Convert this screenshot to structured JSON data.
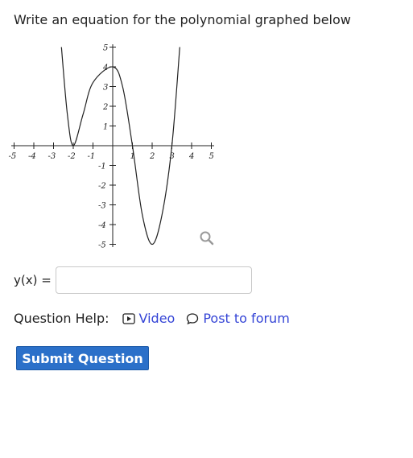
{
  "question": {
    "prompt": "Write an equation for the polynomial graphed below"
  },
  "graph": {
    "x_ticks": [
      -5,
      -4,
      -3,
      -2,
      -1,
      1,
      2,
      3,
      4,
      5
    ],
    "y_ticks": [
      -5,
      -4,
      -3,
      -2,
      -1,
      1,
      2,
      3,
      4,
      5
    ],
    "x_tick_labels": [
      "-5",
      "-4",
      "-3",
      "-2",
      "-1",
      "1",
      "2",
      "3",
      "4",
      "5"
    ],
    "y_tick_labels": [
      "-5",
      "-4",
      "-3",
      "-2",
      "-1",
      "1",
      "2",
      "3",
      "4",
      "5"
    ],
    "xlim": [
      -5,
      5
    ],
    "ylim": [
      -5,
      5
    ],
    "curve_color": "#222222",
    "curve_points": [
      [
        -2.6,
        5
      ],
      [
        -2.3,
        1.6
      ],
      [
        -2,
        0
      ],
      [
        -1.5,
        1.6
      ],
      [
        -1,
        3.2
      ],
      [
        0,
        4.0
      ],
      [
        0.5,
        3.0
      ],
      [
        1,
        0
      ],
      [
        1.5,
        -3.5
      ],
      [
        2,
        -5
      ],
      [
        2.5,
        -3.5
      ],
      [
        3,
        0
      ],
      [
        3.4,
        5
      ]
    ],
    "zoom_icon": "magnifier-icon"
  },
  "answer": {
    "label": "y(x) =",
    "value": "",
    "placeholder": ""
  },
  "help": {
    "label": "Question Help:",
    "video_label": "Video",
    "forum_label": "Post to forum",
    "video_icon": "play-icon",
    "forum_icon": "speech-bubble-icon",
    "link_color": "#3444d6"
  },
  "submit": {
    "label": "Submit Question",
    "color": "#2b70c9"
  }
}
